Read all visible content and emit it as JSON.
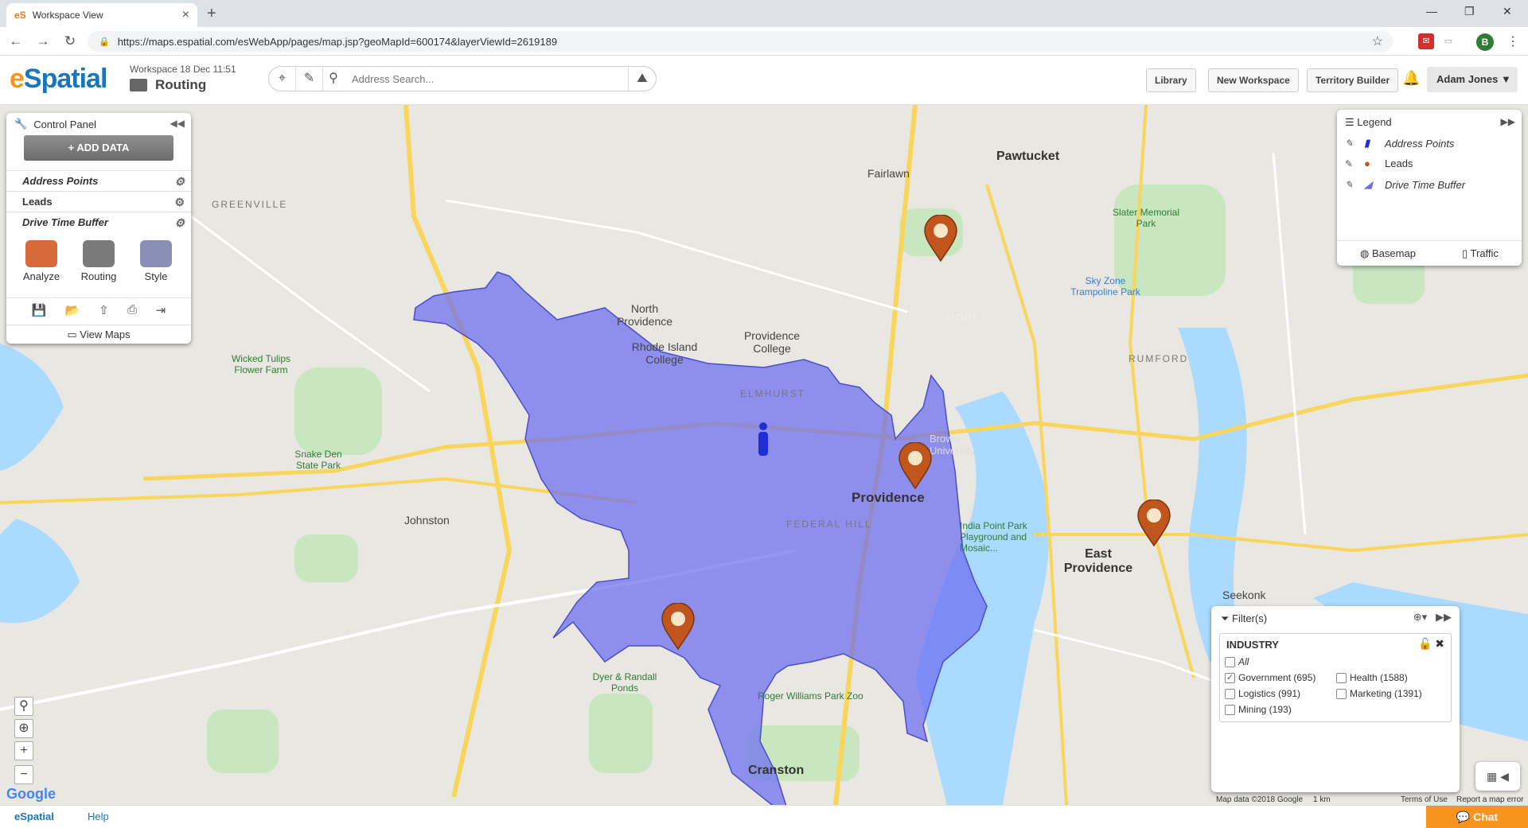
{
  "browser": {
    "tab_title": "Workspace View",
    "favicon": "eS",
    "url": "https://maps.espatial.com/esWebApp/pages/map.jsp?geoMapId=600174&layerViewId=2619189",
    "profile_initial": "B"
  },
  "app": {
    "logo_e": "e",
    "logo_rest": "Spatial",
    "workspace_meta": "Workspace 18 Dec 11:51",
    "workspace_name": "Routing",
    "search_placeholder": "Address Search...",
    "buttons": {
      "library": "Library",
      "new_workspace": "New Workspace",
      "territory_builder": "Territory Builder"
    },
    "user": "Adam Jones"
  },
  "control_panel": {
    "title": "Control Panel",
    "add_data": "ADD DATA",
    "layers": [
      {
        "label": "Address Points"
      },
      {
        "label": "Leads"
      },
      {
        "label": "Drive Time Buffer"
      }
    ],
    "tools": [
      {
        "label": "Analyze"
      },
      {
        "label": "Routing"
      },
      {
        "label": "Style"
      }
    ],
    "view_maps": "View Maps"
  },
  "legend": {
    "title": "Legend",
    "items": [
      {
        "label": "Address Points"
      },
      {
        "label": "Leads"
      },
      {
        "label": "Drive Time Buffer"
      }
    ],
    "basemap": "Basemap",
    "traffic": "Traffic"
  },
  "filter": {
    "title": "Filter(s)",
    "group": "INDUSTRY",
    "options": [
      {
        "label": "All",
        "checked": false
      },
      {
        "label": "Government (695)",
        "checked": true
      },
      {
        "label": "Health (1588)",
        "checked": false
      },
      {
        "label": "Logistics (991)",
        "checked": false
      },
      {
        "label": "Marketing (1391)",
        "checked": false
      },
      {
        "label": "Mining (193)",
        "checked": false
      }
    ]
  },
  "map": {
    "labels": {
      "greenville": "GREENVILLE",
      "pawtucket": "Pawtucket",
      "fairlawn": "Fairlawn",
      "north_providence": "North Providence",
      "rhode_island_college": "Rhode Island College",
      "providence_college": "Providence College",
      "elmhurst": "ELMHURST",
      "providence": "Providence",
      "federal_hill": "FEDERAL HILL",
      "johnston": "Johnston",
      "east_providence": "East Providence",
      "cranston": "Cranston",
      "seekonk": "Seekonk",
      "rumford": "RUMFORD",
      "hope": "HOPE",
      "slater_park": "Slater Memorial Park",
      "sky_zone": "Sky Zone Trampoline Park",
      "wicked_tulips": "Wicked Tulips Flower Farm",
      "snake_den": "Snake Den State Park",
      "dyer_randall": "Dyer & Randall Ponds",
      "roger_williams": "Roger Williams Park Zoo",
      "india_point": "India Point Park Playground and Mosaic...",
      "brown_university": "Brown University"
    },
    "attribution": "Map data ©2018 Google",
    "scale": "1 km",
    "terms": "Terms of Use",
    "report": "Report a map error",
    "google": "Google"
  },
  "footer": {
    "brand": "eSpatial",
    "help": "Help",
    "chat": "Chat"
  },
  "colors": {
    "buffer": "#6b6ef0",
    "lead_pin": "#c0561e",
    "address_point": "#1e2fd6",
    "accent": "#f7941d",
    "brand_blue": "#1b75bb"
  }
}
